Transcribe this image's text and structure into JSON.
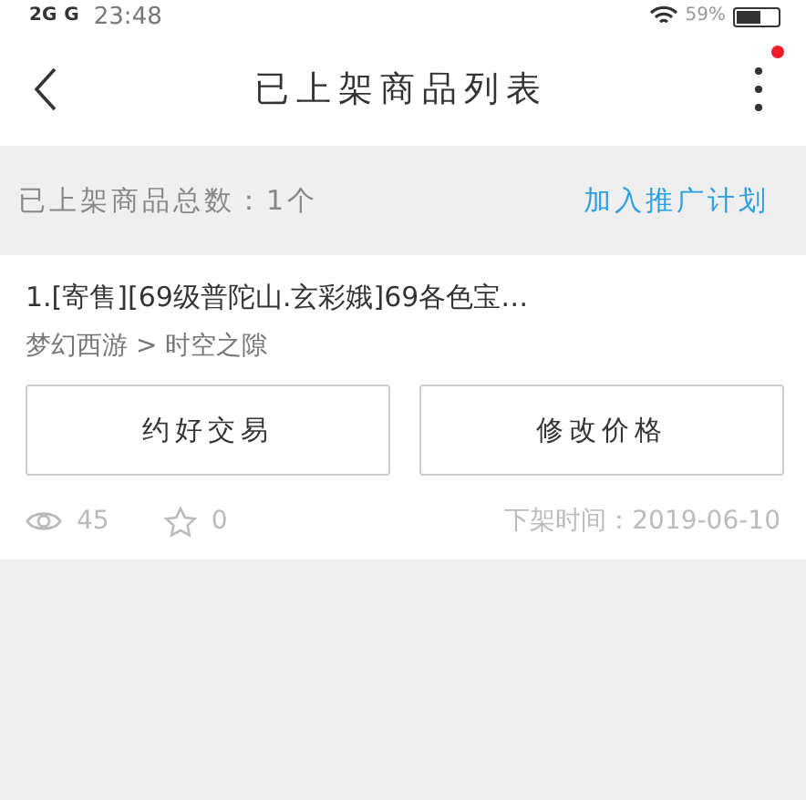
{
  "status_bar": {
    "network": [
      "2G",
      "G"
    ],
    "time": "23:48",
    "battery": "59%"
  },
  "nav": {
    "title": "已上架商品列表",
    "has_notification": true
  },
  "summary": {
    "count_text": "已上架商品总数：1个",
    "action": "加入推广计划"
  },
  "items": [
    {
      "title": "1.[寄售][69级普陀山.玄彩娥]69各色宝…",
      "category": "梦幻西游 > 时空之隙",
      "buttons": [
        "约好交易",
        "修改价格"
      ],
      "views": "45",
      "favorites": "0",
      "offline_time": "下架时间：2019-06-10"
    }
  ]
}
